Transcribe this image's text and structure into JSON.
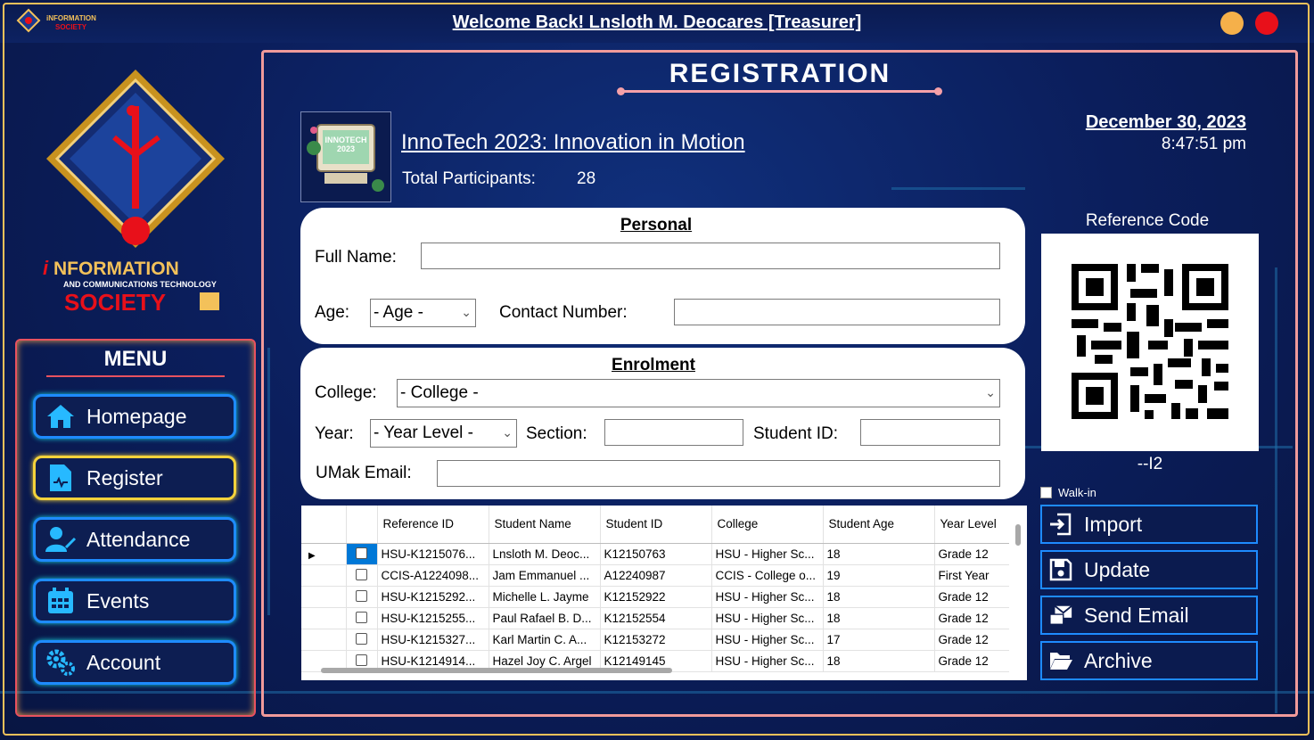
{
  "window": {
    "title": "Welcome Back! Lnsloth M. Deocares [Treasurer]",
    "minimize_color": "#f5b04a",
    "close_color": "#e8101a"
  },
  "brand": {
    "top_logo_text": "INFORMATION SOCIETY",
    "logo_main": "iNFORMATION",
    "logo_sub": "AND COMMUNICATIONS TECHNOLOGY",
    "logo_society": "SOCIETY"
  },
  "sidebar": {
    "menu_title": "MENU",
    "items": [
      {
        "label": "Homepage",
        "icon": "home-icon"
      },
      {
        "label": "Register",
        "icon": "register-form-icon",
        "active": true
      },
      {
        "label": "Attendance",
        "icon": "attendance-user-icon"
      },
      {
        "label": "Events",
        "icon": "calendar-icon"
      },
      {
        "label": "Account",
        "icon": "gears-icon"
      }
    ]
  },
  "page": {
    "title": "REGISTRATION",
    "event_name": "InnoTech 2023: Innovation in Motion",
    "event_thumb_text": "INNOTECH 2023",
    "participants_label": "Total Participants:",
    "participants_count": "28",
    "date": "December 30, 2023",
    "time": "8:47:51 pm"
  },
  "personal": {
    "section_title": "Personal",
    "full_name_label": "Full Name:",
    "full_name_value": "",
    "age_label": "Age:",
    "age_selected": "- Age -",
    "contact_label": "Contact Number:",
    "contact_value": ""
  },
  "enrolment": {
    "section_title": "Enrolment",
    "college_label": "College:",
    "college_selected": "- College -",
    "year_label": "Year:",
    "year_selected": "- Year Level -",
    "section_label": "Section:",
    "section_value": "",
    "student_id_label": "Student ID:",
    "student_id_value": "",
    "email_label": "UMak Email:",
    "email_value": ""
  },
  "grid": {
    "columns": [
      "Reference ID",
      "Student Name",
      "Student ID",
      "College",
      "Student Age",
      "Year Level"
    ],
    "rows": [
      [
        "HSU-K1215076...",
        "Lnsloth M. Deoc...",
        "K12150763",
        "HSU - Higher Sc...",
        "18",
        "Grade 12"
      ],
      [
        "CCIS-A1224098...",
        "Jam Emmanuel ...",
        "A12240987",
        "CCIS - College o...",
        "19",
        "First Year"
      ],
      [
        "HSU-K1215292...",
        "Michelle L. Jayme",
        "K12152922",
        "HSU - Higher Sc...",
        "18",
        "Grade 12"
      ],
      [
        "HSU-K1215255...",
        "Paul Rafael B. D...",
        "K12152554",
        "HSU - Higher Sc...",
        "18",
        "Grade 12"
      ],
      [
        "HSU-K1215327...",
        "Karl Martin C. A...",
        "K12153272",
        "HSU - Higher Sc...",
        "17",
        "Grade 12"
      ],
      [
        "HSU-K1214914...",
        "Hazel Joy C. Argel",
        "K12149145",
        "HSU - Higher Sc...",
        "18",
        "Grade 12"
      ]
    ]
  },
  "reference": {
    "label": "Reference Code",
    "code": "--I2",
    "walkin_label": "Walk-in"
  },
  "actions": [
    {
      "label": "Import",
      "icon": "import-icon"
    },
    {
      "label": "Update",
      "icon": "save-icon"
    },
    {
      "label": "Send Email",
      "icon": "send-email-icon"
    },
    {
      "label": "Archive",
      "icon": "folder-open-icon"
    }
  ]
}
